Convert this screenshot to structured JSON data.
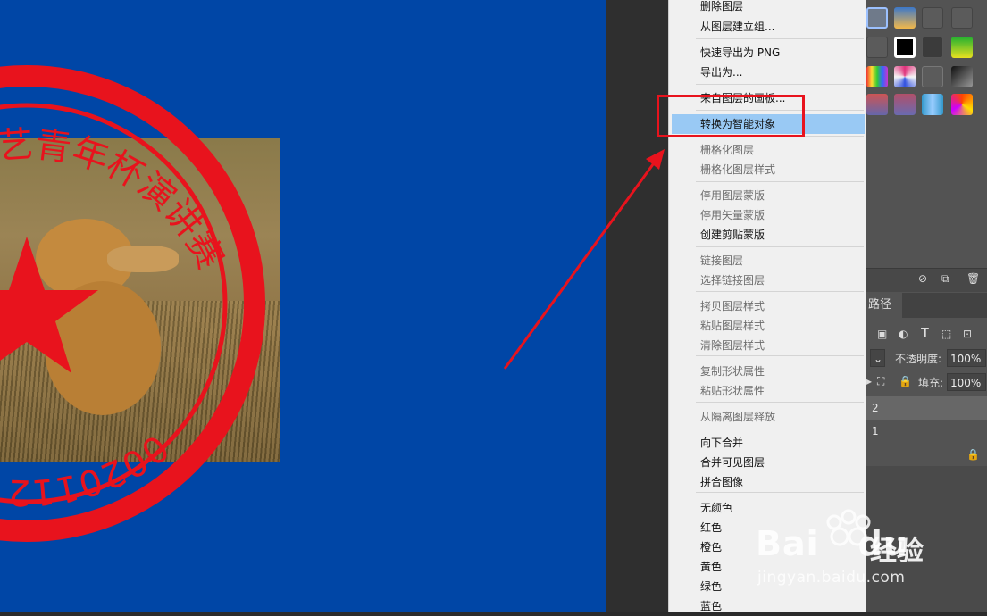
{
  "context_menu": {
    "items": [
      {
        "label": "删除图层",
        "enabled": true
      },
      {
        "label": "从图层建立组...",
        "enabled": true
      },
      {
        "label": "快速导出为 PNG",
        "enabled": true
      },
      {
        "label": "导出为...",
        "enabled": true
      },
      {
        "label": "来自图层的画板...",
        "enabled": true
      },
      {
        "label": "转换为智能对象",
        "enabled": true,
        "highlighted": true
      },
      {
        "label": "栅格化图层",
        "enabled": false
      },
      {
        "label": "栅格化图层样式",
        "enabled": false
      },
      {
        "label": "停用图层蒙版",
        "enabled": false
      },
      {
        "label": "停用矢量蒙版",
        "enabled": false
      },
      {
        "label": "创建剪贴蒙版",
        "enabled": true
      },
      {
        "label": "链接图层",
        "enabled": false
      },
      {
        "label": "选择链接图层",
        "enabled": false
      },
      {
        "label": "拷贝图层样式",
        "enabled": false
      },
      {
        "label": "粘贴图层样式",
        "enabled": false
      },
      {
        "label": "清除图层样式",
        "enabled": false
      },
      {
        "label": "复制形状属性",
        "enabled": false
      },
      {
        "label": "粘贴形状属性",
        "enabled": false
      },
      {
        "label": "从隔离图层释放",
        "enabled": false
      },
      {
        "label": "向下合并",
        "enabled": true
      },
      {
        "label": "合并可见图层",
        "enabled": true
      },
      {
        "label": "拼合图像",
        "enabled": true
      },
      {
        "label": "无颜色",
        "enabled": true
      },
      {
        "label": "红色",
        "enabled": true
      },
      {
        "label": "橙色",
        "enabled": true
      },
      {
        "label": "黄色",
        "enabled": true
      },
      {
        "label": "绿色",
        "enabled": true
      },
      {
        "label": "蓝色",
        "enabled": true
      }
    ]
  },
  "layers_panel": {
    "tab_paths": "路径",
    "opacity_label": "不透明度:",
    "opacity_value": "100%",
    "fill_label": "填充:",
    "fill_value": "100%",
    "layer_rows": [
      "2",
      "1"
    ]
  },
  "seal": {
    "text_arc": "艺青年杯演讲赛",
    "number_arc": "0020112"
  },
  "watermark": {
    "brand_latin": "Bai",
    "brand_latin2": "du",
    "brand_cn": "经验",
    "url": "jingyan.baidu.com"
  },
  "colors": {
    "canvas_bg": "#0046a6",
    "seal_red": "#e8131d",
    "menu_bg": "#f0f0f0",
    "menu_highlight": "#99c9f4",
    "annotation_red": "#e8131d",
    "panel_bg": "#535353"
  }
}
